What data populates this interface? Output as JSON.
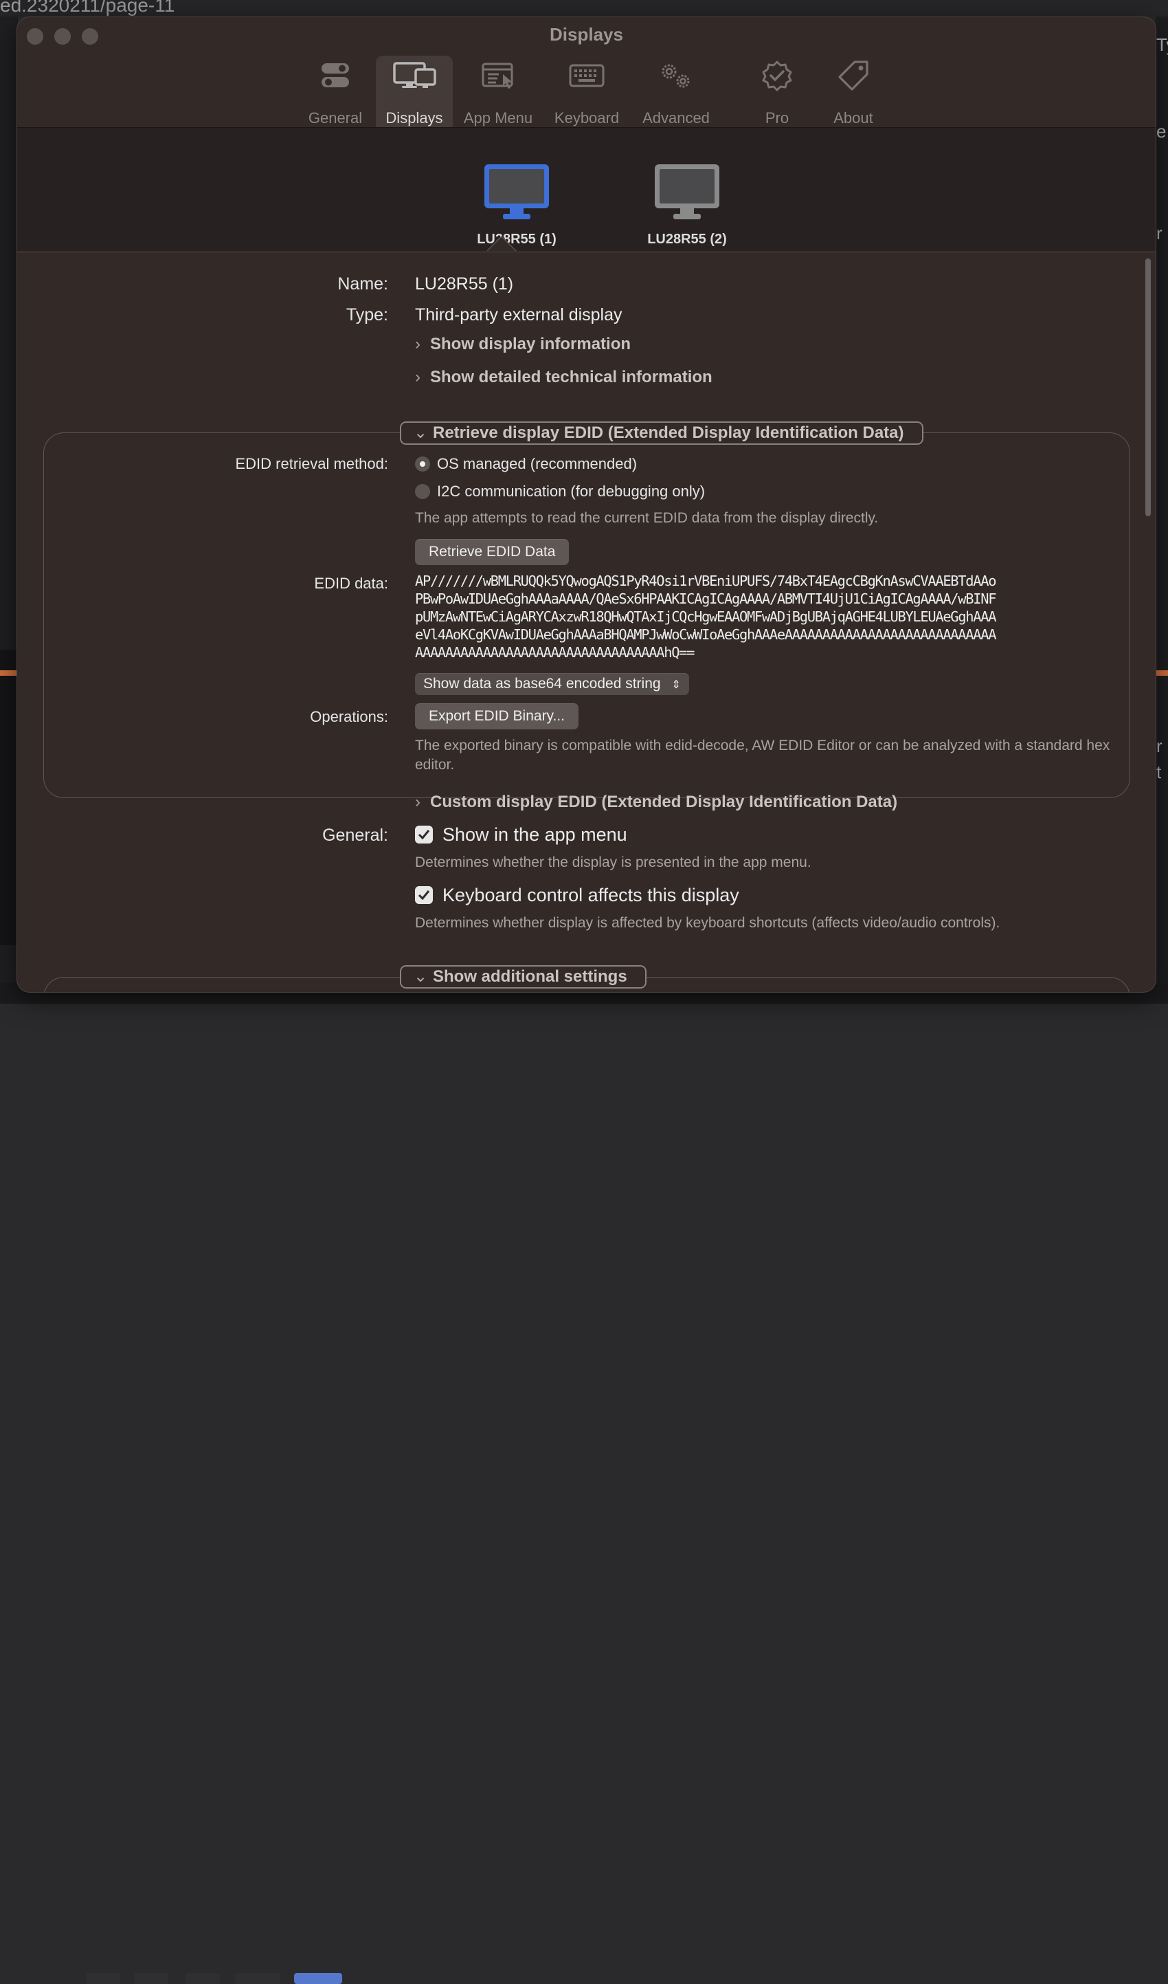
{
  "background": {
    "path_fragment": "ed.2320211/page-11",
    "right_chars": [
      "Ty",
      "e",
      "r",
      "r",
      "t"
    ]
  },
  "window": {
    "title": "Displays"
  },
  "toolbar": {
    "tabs": [
      {
        "label": "General",
        "icon": "toggles-icon"
      },
      {
        "label": "Displays",
        "icon": "displays-icon",
        "active": true
      },
      {
        "label": "App Menu",
        "icon": "app-menu-icon"
      },
      {
        "label": "Keyboard",
        "icon": "keyboard-icon"
      },
      {
        "label": "Advanced",
        "icon": "gears-icon"
      },
      {
        "label": "Pro",
        "icon": "badge-check-icon"
      },
      {
        "label": "About",
        "icon": "tag-icon"
      }
    ]
  },
  "displays": [
    {
      "name": "LU28R55 (1)",
      "selected": true
    },
    {
      "name": "LU28R55 (2)",
      "selected": false
    }
  ],
  "details": {
    "name_label": "Name:",
    "name_value": "LU28R55 (1)",
    "type_label": "Type:",
    "type_value": "Third-party external display",
    "show_display_info": "Show display information",
    "show_technical_info": "Show detailed technical information"
  },
  "edid_section": {
    "title": "Retrieve display EDID (Extended Display Identification Data)",
    "method_label": "EDID retrieval method:",
    "method_options": [
      "OS managed (recommended)",
      "I2C communication (for debugging only)"
    ],
    "method_selected": "OS managed (recommended)",
    "method_note": "The app attempts to read the current EDID data from the display directly.",
    "retrieve_button": "Retrieve EDID Data",
    "data_label": "EDID data:",
    "data_lines": [
      "AP///////wBMLRUQQk5YQwogAQS1PyR4Osi1rVBEniUPUFS/74BxT4EAgcCBgKnAswCVAAEBTdAAo",
      "PBwPoAwIDUAeGghAAAaAAAA/QAeSx6HPAAKICAgICAgAAAA/ABMVTI4UjU1CiAgICAgAAAA/wBINF",
      "pUMzAwNTEwCiAgARYCAxzwR18QHwQTAxIjCQcHgwEAAOMFwADjBgUBAjqAGHE4LUBYLEUAeGghAAA",
      "eVl4AoKCgKVAwIDUAeGghAAAaBHQAMPJwWoCwWIoAeGghAAAeAAAAAAAAAAAAAAAAAAAAAAAAAAAA",
      "AAAAAAAAAAAAAAAAAAAAAAAAAAAAAAAAAhQ=="
    ],
    "format_select": "Show data as base64 encoded string",
    "operations_label": "Operations:",
    "export_button": "Export EDID Binary...",
    "export_note": "The exported binary is compatible with edid-decode, AW EDID Editor or can be analyzed with a standard hex editor."
  },
  "custom_edid": "Custom display EDID (Extended Display Identification Data)",
  "general": {
    "label": "General:",
    "show_in_menu": "Show in the app menu",
    "show_in_menu_checked": true,
    "show_in_menu_note": "Determines whether the display is presented in the app menu.",
    "keyboard_control": "Keyboard control affects this display",
    "keyboard_control_checked": true,
    "keyboard_control_note": "Determines whether display is affected by keyboard shortcuts (affects video/audio controls)."
  },
  "additional_settings": "Show additional settings",
  "colors": {
    "window_bg": "#332a28",
    "selected_display": "#3d6fd6",
    "unselected_display": "#8a8a8a"
  }
}
